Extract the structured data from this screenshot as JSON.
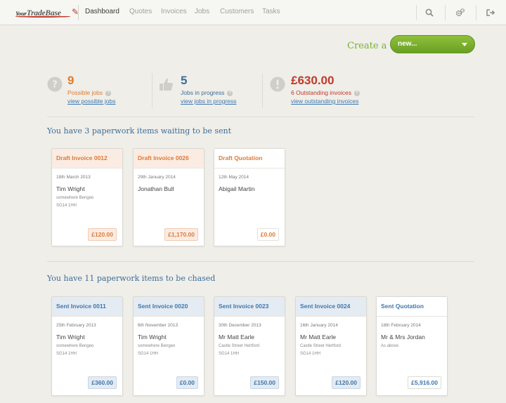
{
  "nav": {
    "logo_your": "Your",
    "logo_brand": "TradeBase",
    "items": [
      {
        "label": "Dashboard",
        "active": true
      },
      {
        "label": "Quotes",
        "active": false
      },
      {
        "label": "Invoices",
        "active": false
      },
      {
        "label": "Jobs",
        "active": false
      },
      {
        "label": "Customers",
        "active": false
      },
      {
        "label": "Tasks",
        "active": false
      }
    ],
    "icons": [
      "search-icon",
      "settings-gears-icon",
      "logout-icon"
    ]
  },
  "create": {
    "label": "Create a",
    "button": "new..."
  },
  "stats": [
    {
      "value": "9",
      "label": "Possible jobs",
      "link": "view possible jobs",
      "icon": "question-icon",
      "color": "#e07b2e"
    },
    {
      "value": "5",
      "label": "Jobs in progress",
      "link": "view jobs in progress",
      "icon": "thumbs-up-icon",
      "color": "#3e6d97"
    },
    {
      "value": "£630.00",
      "label": "6 Outstanding invoices",
      "link": "view outstanding invoices",
      "icon": "alert-icon",
      "color": "#c0392b"
    }
  ],
  "waiting": {
    "title": "You have 3 paperwork items waiting to be sent",
    "cards": [
      {
        "title": "Draft Invoice 0012",
        "date": "18th March 2013",
        "name": "Tim Wright",
        "addr1": "somewhere Bengeo",
        "addr2": "SG14 1HH",
        "amount": "£120.00"
      },
      {
        "title": "Draft Invoice 0026",
        "date": "29th January 2014",
        "name": "Jonathan Bull",
        "addr1": "",
        "addr2": "",
        "amount": "£1,170.00"
      },
      {
        "title": "Draft Quotation",
        "date": "12th May 2014",
        "name": "Abigail Martin",
        "addr1": "",
        "addr2": "",
        "amount": "£0.00"
      }
    ]
  },
  "chased": {
    "title": "You have 11 paperwork items to be chased",
    "cards": [
      {
        "title": "Sent Invoice 0011",
        "date": "25th February 2013",
        "name": "Tim Wright",
        "addr1": "somewhere Bengeo",
        "addr2": "SG14 1HH",
        "amount": "£360.00"
      },
      {
        "title": "Sent Invoice 0020",
        "date": "6th November 2013",
        "name": "Tim Wright",
        "addr1": "somewhere Bengeo",
        "addr2": "SG14 1HH",
        "amount": "£0.00"
      },
      {
        "title": "Sent Invoice 0023",
        "date": "30th December 2013",
        "name": "Mr Matt Earle",
        "addr1": "Castle Street Hertford",
        "addr2": "SG14 1HH",
        "amount": "£150.00"
      },
      {
        "title": "Sent Invoice 0024",
        "date": "16th January 2014",
        "name": "Mr Matt Earle",
        "addr1": "Castle Street Hertford",
        "addr2": "SG14 1HH",
        "amount": "£120.00"
      },
      {
        "title": "Sent Quotation",
        "date": "18th February 2014",
        "name": "Mr & Mrs Jordan",
        "addr1": "As above",
        "addr2": "",
        "amount": "£5,916.00"
      }
    ]
  },
  "colors": {
    "accent_green": "#7ab034",
    "orange": "#dd7a36",
    "blue": "#3f77ad",
    "red": "#c0392b"
  }
}
